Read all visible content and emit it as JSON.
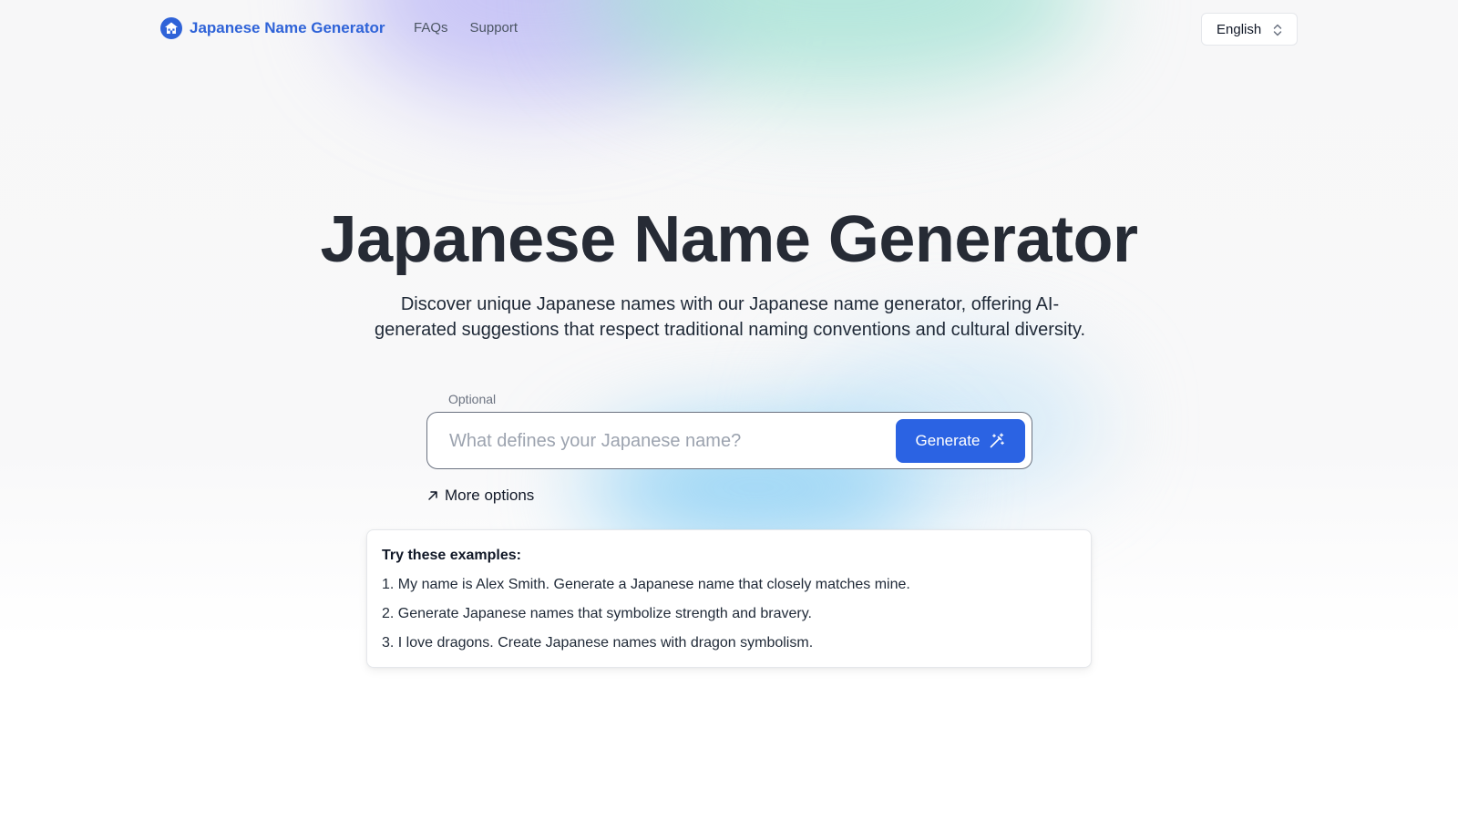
{
  "header": {
    "brand_name": "Japanese Name Generator",
    "logo_icon": "house-logo-icon",
    "nav": [
      {
        "label": "FAQs"
      },
      {
        "label": "Support"
      }
    ],
    "language": {
      "selected": "English",
      "icon": "chevron-updown-icon"
    }
  },
  "hero": {
    "title": "Japanese Name Generator",
    "description": "Discover unique Japanese names with our Japanese name generator, offering AI-generated suggestions that respect traditional naming conventions and cultural diversity."
  },
  "form": {
    "optional_label": "Optional",
    "input_value": "",
    "input_placeholder": "What defines your Japanese name?",
    "generate_label": "Generate",
    "generate_icon": "magic-wand-icon",
    "more_options_label": "More options",
    "more_options_icon": "arrow-up-right-icon"
  },
  "examples": {
    "title": "Try these examples:",
    "items": [
      "1. My name is Alex Smith. Generate a Japanese name that closely matches mine.",
      "2. Generate Japanese names that symbolize strength and bravery.",
      "3. I love dragons. Create Japanese names with dragon symbolism."
    ]
  },
  "colors": {
    "brand": "#2f63d8",
    "primary_button": "#2b63e3",
    "title_text": "#262b35"
  }
}
